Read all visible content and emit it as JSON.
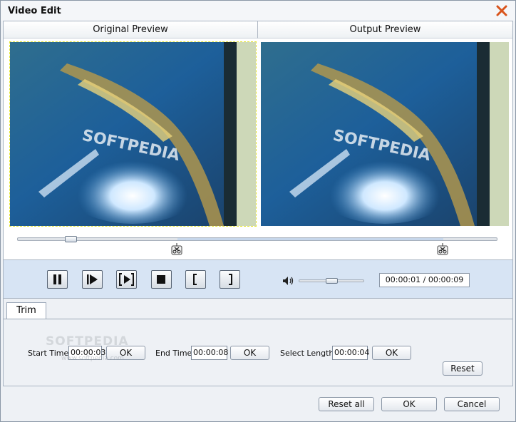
{
  "window": {
    "title": "Video Edit"
  },
  "preview": {
    "original_label": "Original Preview",
    "output_label": "Output Preview",
    "video_watermark": "SOFTPEDIA"
  },
  "playback": {
    "seek_position": 0.1,
    "trim_start": 0.333,
    "trim_end": 0.889,
    "volume": 0.5,
    "time": "00:00:01 / 00:00:09"
  },
  "tabs": [
    {
      "label": "Trim"
    }
  ],
  "trim": {
    "start_label": "Start Time",
    "start_value": "00:00:03",
    "end_label": "End Time",
    "end_value": "00:00:08",
    "length_label": "Select Length",
    "length_value": "00:00:04",
    "ok_label": "OK",
    "reset_label": "Reset"
  },
  "watermark": {
    "main": "SOFTPEDIA",
    "sub": "www.softpedia.com"
  },
  "footer": {
    "reset_all_label": "Reset all",
    "ok_label": "OK",
    "cancel_label": "Cancel"
  },
  "colors": {
    "controls_band": "#d7e4f4",
    "close_icon": "#d9541c"
  }
}
